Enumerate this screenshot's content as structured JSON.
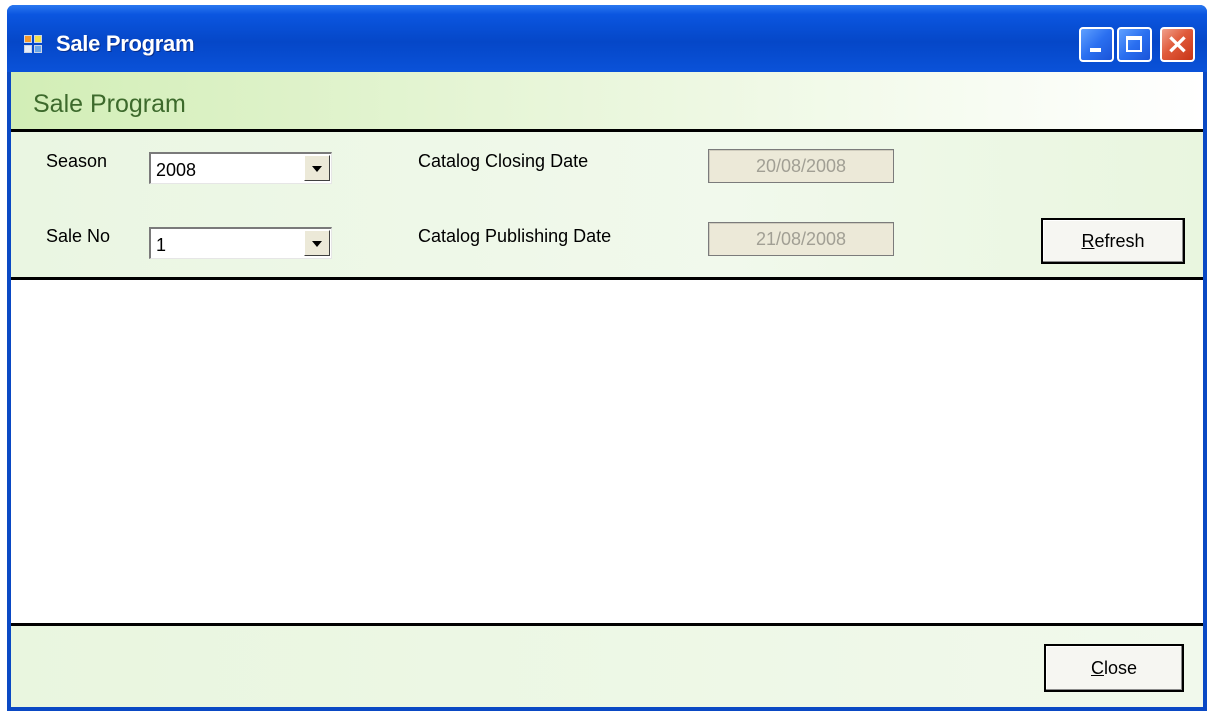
{
  "window": {
    "title": "Sale Program"
  },
  "header": {
    "title": "Sale Program"
  },
  "filters": {
    "season": {
      "label": "Season",
      "value": "2008"
    },
    "sale_no": {
      "label": "Sale No",
      "value": "1"
    },
    "catalog_closing": {
      "label": "Catalog Closing Date",
      "value": "20/08/2008"
    },
    "catalog_publishing": {
      "label": "Catalog Publishing Date",
      "value": "21/08/2008"
    },
    "refresh": {
      "mnemonic": "R",
      "rest": "efresh"
    }
  },
  "footer": {
    "close": {
      "mnemonic": "C",
      "rest": "lose"
    }
  }
}
